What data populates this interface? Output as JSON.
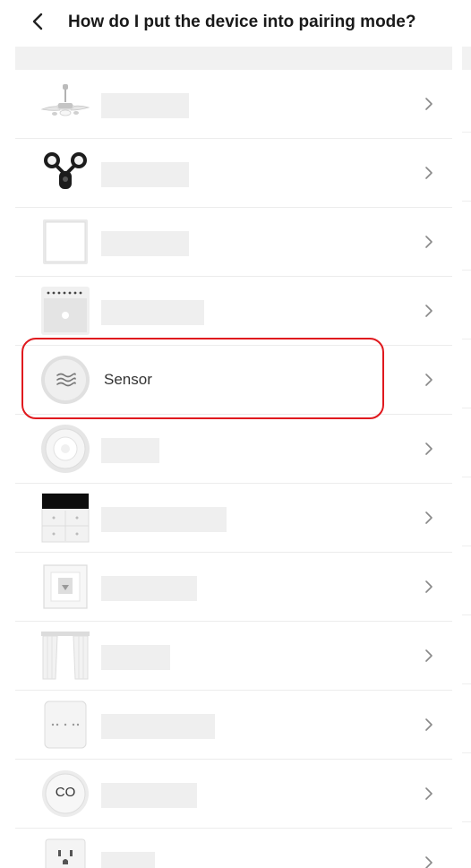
{
  "header": {
    "title": "How do I put the device into pairing mode?",
    "back_icon": "chevron-left-icon"
  },
  "devices": [
    {
      "id": "ceiling-fan",
      "icon": "ceiling-fan-icon",
      "label": ""
    },
    {
      "id": "floodlight-camera",
      "icon": "floodlight-camera-icon",
      "label": ""
    },
    {
      "id": "wall-switch",
      "icon": "wall-switch-icon",
      "label": ""
    },
    {
      "id": "light-bar",
      "icon": "light-bar-icon",
      "label": ""
    },
    {
      "id": "sensor",
      "icon": "sensor-icon",
      "label": "Sensor",
      "highlighted": true
    },
    {
      "id": "smoke-detector",
      "icon": "smoke-detector-icon",
      "label": ""
    },
    {
      "id": "control-panel",
      "icon": "control-panel-icon",
      "label": ""
    },
    {
      "id": "wall-plug",
      "icon": "wall-plug-icon",
      "label": ""
    },
    {
      "id": "curtain",
      "icon": "curtain-icon",
      "label": ""
    },
    {
      "id": "gateway",
      "icon": "gateway-icon",
      "label": ""
    },
    {
      "id": "co-detector",
      "icon": "co-detector-icon",
      "label": "",
      "icon_text": "CO"
    },
    {
      "id": "outlet",
      "icon": "outlet-icon",
      "label": ""
    }
  ],
  "highlight_color": "#e0191e"
}
